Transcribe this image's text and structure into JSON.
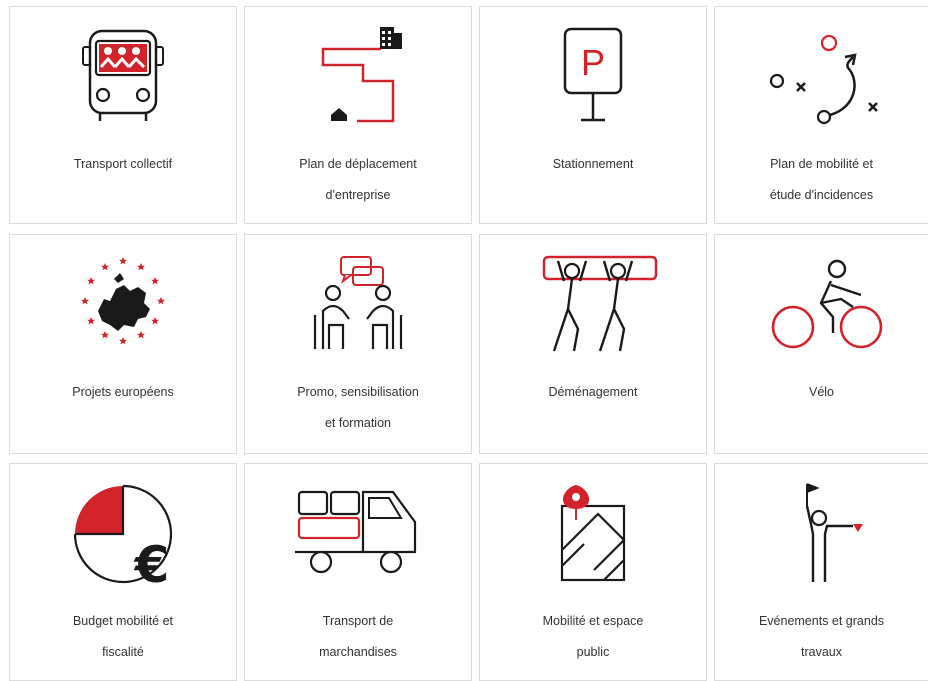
{
  "colors": {
    "accent": "#d2232a",
    "icon_stroke": "#1a1a1a",
    "border": "#dcdcdc",
    "text": "#333333"
  },
  "tiles": [
    {
      "icon": "bus-icon",
      "label": [
        "Transport collectif"
      ]
    },
    {
      "icon": "commute-route-icon",
      "label": [
        "Plan de déplacement",
        "d'entreprise"
      ]
    },
    {
      "icon": "parking-sign-icon",
      "label": [
        "Stationnement"
      ]
    },
    {
      "icon": "mobility-strategy-icon",
      "label": [
        "Plan de mobilité et",
        "étude d'incidences"
      ]
    },
    {
      "icon": "eu-map-icon",
      "label": [
        "Projets européens"
      ]
    },
    {
      "icon": "meeting-discussion-icon",
      "label": [
        "Promo, sensibilisation",
        "et formation"
      ]
    },
    {
      "icon": "movers-icon",
      "label": [
        "Déménagement"
      ]
    },
    {
      "icon": "cyclist-icon",
      "label": [
        "Vélo"
      ]
    },
    {
      "icon": "budget-euro-icon",
      "label": [
        "Budget mobilité et",
        "fiscalité"
      ]
    },
    {
      "icon": "delivery-truck-icon",
      "label": [
        "Transport de",
        "marchandises"
      ]
    },
    {
      "icon": "map-pin-icon",
      "label": [
        "Mobilité et espace",
        "public"
      ]
    },
    {
      "icon": "flag-person-icon",
      "label": [
        "Evénements et grands",
        "travaux"
      ]
    }
  ]
}
